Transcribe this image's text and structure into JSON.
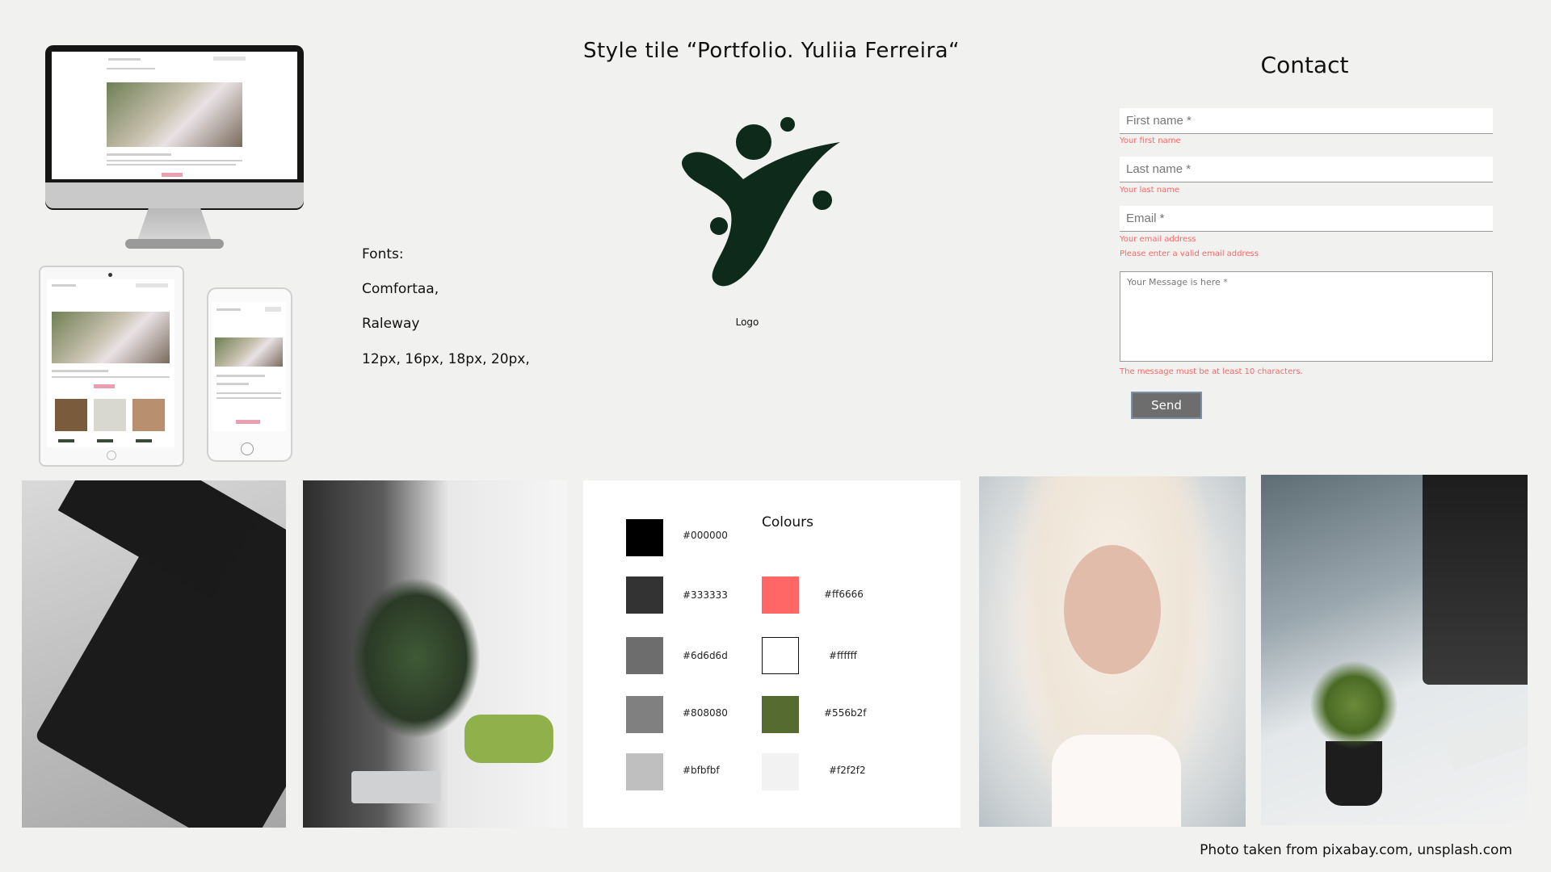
{
  "title": "Style tile “Portfolio. Yuliia Ferreira“",
  "fonts": {
    "heading": "Fonts:",
    "font1": "Comfortaa,",
    "font2": "Raleway",
    "sizes": "12px, 16px, 18px, 20px,"
  },
  "logo": {
    "caption": "Logo",
    "color": "#0d2a1b"
  },
  "contact": {
    "heading": "Contact",
    "first_name_placeholder": "First name *",
    "first_name_hint": "Your first name",
    "last_name_placeholder": "Last name *",
    "last_name_hint": "Your last name",
    "email_placeholder": "Email *",
    "email_hint": "Your email address",
    "email_error": "Please enter a valid email address",
    "message_placeholder": "Your Message is here *",
    "message_error": "The message must be at least 10 characters.",
    "send_label": "Send"
  },
  "colours": {
    "title": "Colours",
    "left": [
      {
        "label": "#000000",
        "hex": "#000000"
      },
      {
        "label": "#333333",
        "hex": "#333333"
      },
      {
        "label": "#6d6d6d",
        "hex": "#6d6d6d"
      },
      {
        "label": "#808080",
        "hex": "#808080"
      },
      {
        "label": "#bfbfbf",
        "hex": "#bfbfbf"
      }
    ],
    "right": [
      {
        "label": "#ff6666",
        "hex": "#ff6666"
      },
      {
        "label": "#ffffff",
        "hex": "#ffffff"
      },
      {
        "label": "#556b2f",
        "hex": "#556b2f"
      },
      {
        "label": "#f2f2f2",
        "hex": "#f2f2f2"
      }
    ]
  },
  "credit": "Photo taken from pixabay.com, unsplash.com"
}
